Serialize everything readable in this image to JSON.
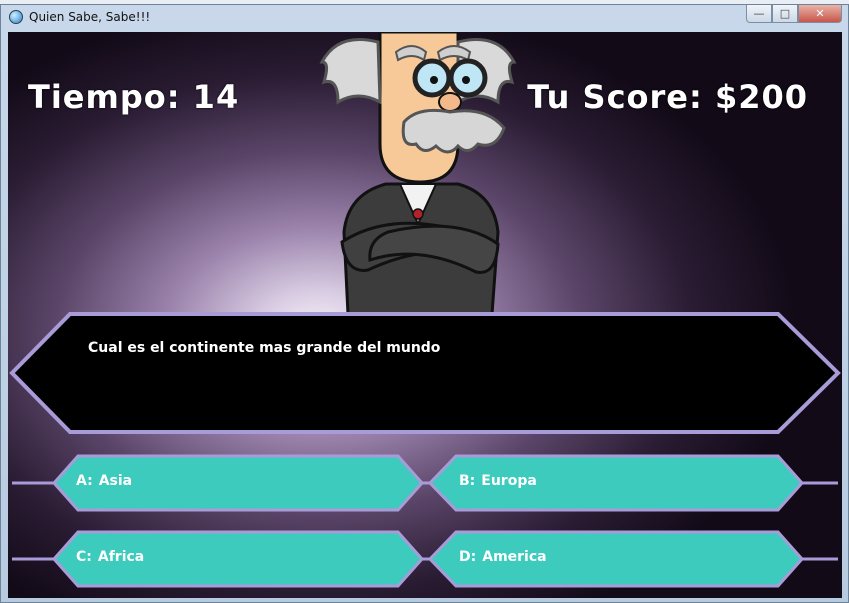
{
  "window": {
    "title": "Quien Sabe, Sabe!!!"
  },
  "hud": {
    "time_label": "Tiempo: 14",
    "score_label": "Tu Score: $200"
  },
  "question": {
    "text": "Cual es el continente mas grande del mundo"
  },
  "answers": [
    {
      "letter": "A:",
      "text": "Asia"
    },
    {
      "letter": "B:",
      "text": "Europa"
    },
    {
      "letter": "C:",
      "text": "Africa"
    },
    {
      "letter": "D:",
      "text": "America"
    }
  ],
  "colors": {
    "answer_fill": "#3dcbbd",
    "frame_stroke": "#a89bd8",
    "question_fill": "#000000"
  }
}
